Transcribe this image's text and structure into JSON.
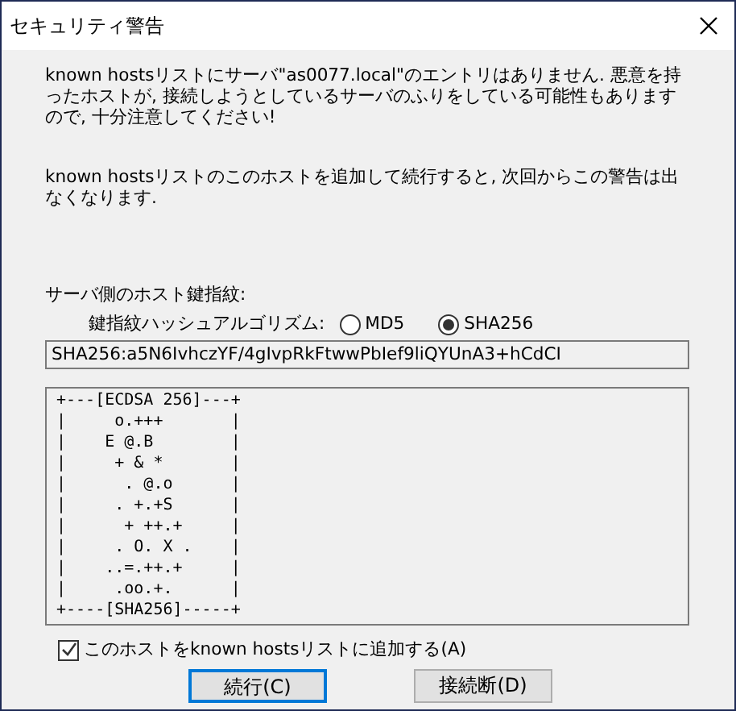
{
  "window": {
    "title": "セキュリティ警告"
  },
  "messages": [
    "known hostsリストにサーバ\"as0077.local\"のエントリはありません. 悪意を持ったホストが, 接続しようとしているサーバのふりをしている可能性もありますので, 十分注意してください!",
    "known hostsリストのこのホストを追加して続行すると, 次回からこの警告は出なくなります."
  ],
  "fingerprint": {
    "label": "サーバ側のホスト鍵指紋:",
    "algorithm_label": "鍵指紋ハッシュアルゴリズム:",
    "algorithms": [
      {
        "label": "MD5",
        "selected": false
      },
      {
        "label": "SHA256",
        "selected": true
      }
    ],
    "value": "SHA256:a5N6IvhczYF/4gIvpRkFtwwPbIef9liQYUnA3+hCdCI"
  },
  "randomart": [
    "+---[ECDSA 256]---+",
    "|     o.+++       |",
    "|    E @.B        |",
    "|     + & *       |",
    "|      . @.o      |",
    "|     . +.+S      |",
    "|      + ++.+     |",
    "|     . O. X .    |",
    "|    ..=.++.+     |",
    "|     .oo.+.      |",
    "+----[SHA256]-----+"
  ],
  "add_checkbox": {
    "label": "このホストをknown hostsリストに追加する(A)",
    "checked": true
  },
  "buttons": [
    {
      "label": "続行(C)",
      "default": true
    },
    {
      "label": "接続断(D)",
      "default": false
    }
  ]
}
